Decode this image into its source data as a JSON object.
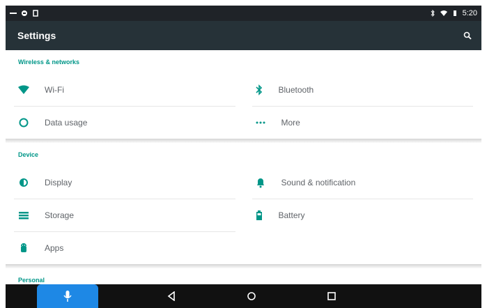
{
  "status_bar": {
    "time": "5:20",
    "left_icons": [
      "notification-small-icon",
      "android-icon",
      "sim-icon"
    ],
    "right_icons": [
      "bluetooth-icon",
      "wifi-icon",
      "battery-icon"
    ]
  },
  "app_bar": {
    "title": "Settings",
    "search_icon": "search-icon"
  },
  "sections": [
    {
      "header": "Wireless & networks",
      "items": [
        {
          "label": "Wi-Fi",
          "icon": "wifi-icon"
        },
        {
          "label": "Bluetooth",
          "icon": "bluetooth-icon"
        },
        {
          "label": "Data usage",
          "icon": "data-usage-icon"
        },
        {
          "label": "More",
          "icon": "more-icon"
        }
      ]
    },
    {
      "header": "Device",
      "items": [
        {
          "label": "Display",
          "icon": "display-icon"
        },
        {
          "label": "Sound & notification",
          "icon": "bell-icon"
        },
        {
          "label": "Storage",
          "icon": "storage-icon"
        },
        {
          "label": "Battery",
          "icon": "battery-icon"
        },
        {
          "label": "Apps",
          "icon": "android-icon"
        }
      ]
    },
    {
      "header": "Personal",
      "items": []
    }
  ],
  "nav_bar": {
    "buttons": [
      "mic-icon",
      "back-icon",
      "home-icon",
      "recent-apps-icon"
    ]
  },
  "colors": {
    "accent": "#009688",
    "app_bar": "#263238",
    "status_bar": "#1f2328",
    "nav_bar": "#111111",
    "mic_button": "#1e88e5"
  }
}
